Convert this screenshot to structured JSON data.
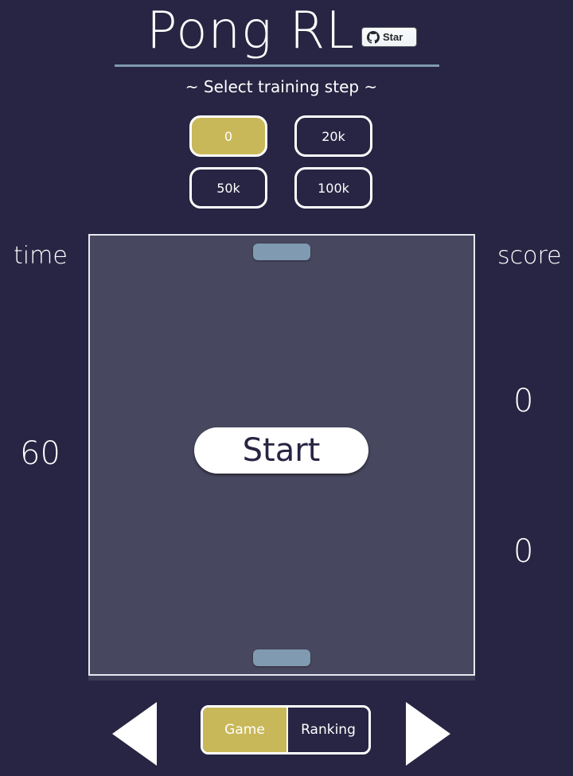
{
  "header": {
    "title": "Pong RL",
    "star_label": "Star",
    "star_icon": "github-icon"
  },
  "training": {
    "caption": "~ Select training step ~",
    "steps": [
      "0",
      "20k",
      "50k",
      "100k"
    ],
    "selected": "0"
  },
  "hud": {
    "time_label": "time",
    "time_value": "60",
    "score_label": "score",
    "score_top": "0",
    "score_bottom": "0"
  },
  "game": {
    "start_label": "Start"
  },
  "nav": {
    "prev_icon": "triangle-left-icon",
    "next_icon": "triangle-right-icon",
    "tabs": [
      "Game",
      "Ranking"
    ],
    "active_tab": "Game"
  },
  "colors": {
    "background": "#272543",
    "accent": "#c9b85a",
    "paddle": "#7f9ab1",
    "field": "#47475f"
  }
}
